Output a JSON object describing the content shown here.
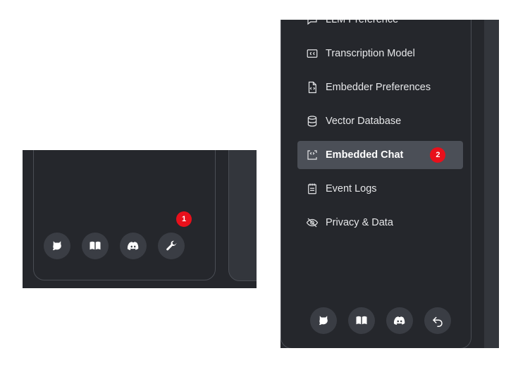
{
  "left_panel": {
    "footer_icons": [
      "github-icon",
      "book-icon",
      "discord-icon",
      "wrench-icon"
    ],
    "badge": "1"
  },
  "right_panel": {
    "menu": [
      {
        "label": "LLM Preference",
        "icon": "chat-icon"
      },
      {
        "label": "Transcription Model",
        "icon": "cc-icon"
      },
      {
        "label": "Embedder Preferences",
        "icon": "code-file-icon"
      },
      {
        "label": "Vector Database",
        "icon": "database-icon"
      },
      {
        "label": "Embedded Chat",
        "icon": "embed-icon",
        "active": true
      },
      {
        "label": "Event Logs",
        "icon": "notepad-icon"
      },
      {
        "label": "Privacy & Data",
        "icon": "eye-slash-icon"
      }
    ],
    "badge": "2",
    "footer_icons": [
      "github-icon",
      "book-icon",
      "discord-icon",
      "back-arrow-icon"
    ]
  },
  "colors": {
    "background": "#25272c",
    "border": "#4a4d54",
    "button": "#3a3d44",
    "active_item": "#4b4f57",
    "badge": "#e8101b"
  }
}
